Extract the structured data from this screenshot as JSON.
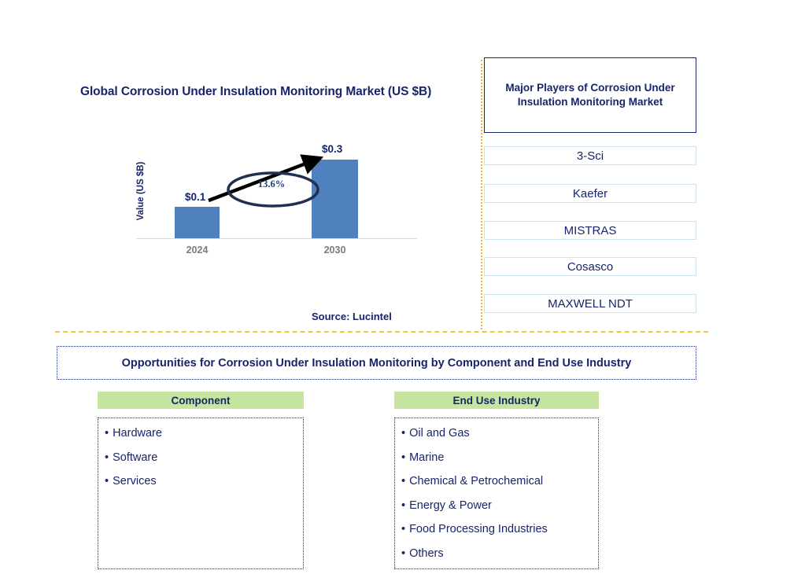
{
  "chart_data": {
    "type": "bar",
    "title": "Global Corrosion Under Insulation Monitoring Market (US $B)",
    "categories": [
      "2024",
      "2030"
    ],
    "values": [
      0.1,
      0.3
    ],
    "value_labels": [
      "$0.1",
      "$0.3"
    ],
    "ylabel": "Value (US $B)",
    "xlabel": "",
    "ylim": [
      0,
      0.35
    ],
    "grid": false,
    "legend": false,
    "annotation": "13.6%",
    "annotation_meaning": "CAGR 2024-2030",
    "series_color": "#4e81bd",
    "source": "Source: Lucintel"
  },
  "chart": {
    "title": "Global Corrosion Under Insulation Monitoring Market (US $B)",
    "y_axis_label": "Value (US $B)",
    "cagr": "13.6%",
    "bars": [
      {
        "category": "2024",
        "label": "$0.1"
      },
      {
        "category": "2030",
        "label": "$0.3"
      }
    ]
  },
  "source": {
    "text": "Source: Lucintel"
  },
  "players_panel": {
    "header": "Major Players of Corrosion Under Insulation Monitoring Market",
    "items": [
      {
        "name": "3-Sci"
      },
      {
        "name": "Kaefer"
      },
      {
        "name": "MISTRAS"
      },
      {
        "name": "Cosasco"
      },
      {
        "name": "MAXWELL NDT"
      }
    ]
  },
  "opportunities": {
    "title": "Opportunities for Corrosion Under Insulation Monitoring by Component and End Use Industry",
    "bullet": "•",
    "columns": [
      {
        "header": "Component",
        "items": [
          "Hardware",
          "Software",
          "Services"
        ]
      },
      {
        "header": "End Use Industry",
        "items": [
          "Oil and Gas",
          "Marine",
          "Chemical & Petrochemical",
          "Energy & Power",
          "Food Processing Industries",
          "Others"
        ]
      }
    ]
  },
  "colors": {
    "bar": "#4e81bd",
    "navy": "#18246b",
    "green_header": "#c6e5a0",
    "orange_divider": "#f7c444",
    "player_border": "#cfe2f0"
  }
}
